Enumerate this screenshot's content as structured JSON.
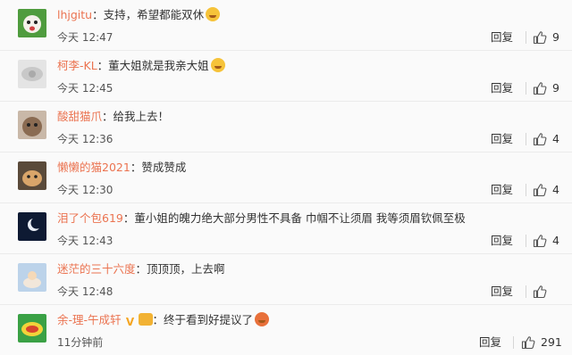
{
  "reply_label": "回复",
  "comments": [
    {
      "username": "lhjgitu",
      "text": "：支持，希望都能双休",
      "time": "今天 12:47",
      "likes": "9"
    },
    {
      "username": "柯李-KL",
      "text": "：董大姐就是我亲大姐",
      "time": "今天 12:45",
      "likes": "9"
    },
    {
      "username": "酸甜猫爪",
      "text": "：给我上去！",
      "time": "今天 12:36",
      "likes": "4"
    },
    {
      "username": "懒懒的猫2021",
      "text": "：赞成赞成",
      "time": "今天 12:30",
      "likes": "4"
    },
    {
      "username": "泪了个包619",
      "text": "：董小姐的魄力绝大部分男性不具备 巾帼不让须眉 我等须眉钦佩至极",
      "time": "今天 12:43",
      "likes": "4"
    },
    {
      "username": "迷茫的三十六度",
      "text": "：顶顶顶，上去啊",
      "time": "今天 12:48",
      "likes": ""
    },
    {
      "username": "余-理-午成轩",
      "text": "：终于看到好提议了",
      "time": "11分钟前",
      "likes": "291"
    }
  ],
  "colors": {
    "username": "#eb7350",
    "text": "#333333",
    "background": "#fafafa"
  }
}
